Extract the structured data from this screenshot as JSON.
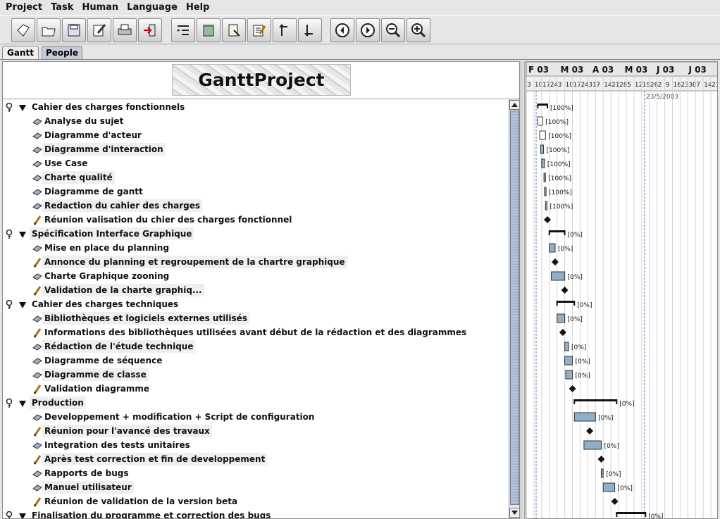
{
  "menu": [
    "Project",
    "Task",
    "Human",
    "Language",
    "Help"
  ],
  "toolbar": [
    {
      "name": "new-icon"
    },
    {
      "name": "open-icon"
    },
    {
      "name": "save-icon"
    },
    {
      "name": "edit-icon"
    },
    {
      "name": "print-icon"
    },
    {
      "name": "exit-icon"
    },
    {
      "name": "new-task-icon"
    },
    {
      "name": "delete-task-icon"
    },
    {
      "name": "task-properties-icon"
    },
    {
      "name": "task-notes-icon"
    },
    {
      "name": "unindent-icon"
    },
    {
      "name": "indent-icon"
    },
    {
      "name": "scroll-back-icon"
    },
    {
      "name": "scroll-forward-icon"
    },
    {
      "name": "zoom-out-icon"
    },
    {
      "name": "zoom-in-icon"
    }
  ],
  "tabs": {
    "gantt": "Gantt",
    "people": "People"
  },
  "logo": "GanttProject",
  "tasks": [
    {
      "label": "Cahier des charges fonctionnels",
      "kind": "group",
      "hl": false
    },
    {
      "label": "Analyse du sujet",
      "kind": "task",
      "hl": false
    },
    {
      "label": "Diagramme d'acteur",
      "kind": "task",
      "hl": false
    },
    {
      "label": "Diagramme d'interaction",
      "kind": "task",
      "hl": true
    },
    {
      "label": "Use Case",
      "kind": "task",
      "hl": false
    },
    {
      "label": "Charte qualité",
      "kind": "task",
      "hl": true
    },
    {
      "label": "Diagramme de gantt",
      "kind": "task",
      "hl": false
    },
    {
      "label": "Redaction du cahier des charges",
      "kind": "task",
      "hl": true
    },
    {
      "label": "Réunion valisation du chier des charges fonctionnel",
      "kind": "milestone",
      "hl": false
    },
    {
      "label": "Spécification Interface Graphique",
      "kind": "group",
      "hl": true
    },
    {
      "label": "Mise en place du planning",
      "kind": "task",
      "hl": false
    },
    {
      "label": "Annonce du planning et regroupement de la chartre graphique",
      "kind": "milestone",
      "hl": true
    },
    {
      "label": "Charte Graphique zooning",
      "kind": "task",
      "hl": false
    },
    {
      "label": "Validation de la charte graphiq...",
      "kind": "milestone",
      "hl": true
    },
    {
      "label": "Cahier des charges techniques",
      "kind": "group",
      "hl": false
    },
    {
      "label": "Bibliothèques et logiciels externes utilisés",
      "kind": "task",
      "hl": true
    },
    {
      "label": "Informations des bibliothèques utilisées avant début de la rédaction et des diagrammes",
      "kind": "milestone",
      "hl": false
    },
    {
      "label": "Rédaction de l'étude technique",
      "kind": "task",
      "hl": true
    },
    {
      "label": "Diagramme de séquence",
      "kind": "task",
      "hl": false
    },
    {
      "label": "Diagramme de classe",
      "kind": "task",
      "hl": true
    },
    {
      "label": "Validation diagramme",
      "kind": "milestone",
      "hl": false
    },
    {
      "label": "Production",
      "kind": "group",
      "hl": true
    },
    {
      "label": "Developpement + modification + Script de configuration",
      "kind": "task",
      "hl": false
    },
    {
      "label": "Réunion pour l'avancé des travaux",
      "kind": "milestone",
      "hl": true
    },
    {
      "label": "Integration des tests unitaires",
      "kind": "task",
      "hl": false
    },
    {
      "label": "Après test correction et fin de developpement",
      "kind": "milestone",
      "hl": true
    },
    {
      "label": "Rapports de bugs",
      "kind": "task",
      "hl": false
    },
    {
      "label": "Manuel utilisateur",
      "kind": "task",
      "hl": true
    },
    {
      "label": "Réunion de validation de la version beta",
      "kind": "milestone",
      "hl": false
    },
    {
      "label": "Finalisation du programme et correction des bugs",
      "kind": "group",
      "hl": false
    }
  ],
  "timeline": {
    "months": [
      {
        "label": "F",
        "year": "03"
      },
      {
        "label": "M",
        "year": "03"
      },
      {
        "label": "A",
        "year": "03"
      },
      {
        "label": "M",
        "year": "03"
      },
      {
        "label": "J",
        "year": "03"
      },
      {
        "label": "J",
        "year": "03"
      }
    ],
    "days": [
      "3",
      "10",
      "17",
      "24",
      "3",
      "10",
      "17",
      "24",
      "31",
      "7",
      "14",
      "21",
      "28",
      "5",
      "12",
      "19",
      "26",
      "2",
      "9",
      "16",
      "23",
      "30",
      "7",
      "14",
      "21"
    ],
    "today_label": "23/5/2003"
  },
  "bars": [
    {
      "type": "summary",
      "start": 0.06,
      "end": 0.11,
      "pct": "[100%]"
    },
    {
      "type": "task",
      "start": 0.06,
      "end": 0.085,
      "pct": "[100%]",
      "outline": true
    },
    {
      "type": "task",
      "start": 0.07,
      "end": 0.1,
      "pct": "[100%]",
      "outline": true
    },
    {
      "type": "task",
      "start": 0.075,
      "end": 0.09,
      "pct": "[100%]"
    },
    {
      "type": "task",
      "start": 0.08,
      "end": 0.095,
      "pct": "[100%]"
    },
    {
      "type": "task",
      "start": 0.092,
      "end": 0.1,
      "pct": "[100%]"
    },
    {
      "type": "task",
      "start": 0.095,
      "end": 0.103,
      "pct": "[100%]"
    },
    {
      "type": "task",
      "start": 0.1,
      "end": 0.108,
      "pct": "[100%]"
    },
    {
      "type": "milestone",
      "start": 0.11,
      "pct": ""
    },
    {
      "type": "summary",
      "start": 0.12,
      "end": 0.2,
      "pct": "[0%]"
    },
    {
      "type": "task",
      "start": 0.12,
      "end": 0.15,
      "pct": "[0%]"
    },
    {
      "type": "milestone",
      "start": 0.15,
      "pct": ""
    },
    {
      "type": "task",
      "start": 0.13,
      "end": 0.2,
      "pct": "[0%]"
    },
    {
      "type": "milestone",
      "start": 0.2,
      "pct": ""
    },
    {
      "type": "summary",
      "start": 0.16,
      "end": 0.25,
      "pct": "[0%]"
    },
    {
      "type": "task",
      "start": 0.16,
      "end": 0.2,
      "pct": "[0%]"
    },
    {
      "type": "milestone",
      "start": 0.19,
      "pct": ""
    },
    {
      "type": "task",
      "start": 0.2,
      "end": 0.22,
      "pct": "[0%]"
    },
    {
      "type": "task",
      "start": 0.2,
      "end": 0.24,
      "pct": "[0%]"
    },
    {
      "type": "task",
      "start": 0.205,
      "end": 0.24,
      "pct": "[0%]"
    },
    {
      "type": "milestone",
      "start": 0.24,
      "pct": ""
    },
    {
      "type": "summary",
      "start": 0.25,
      "end": 0.47,
      "pct": "[0%]"
    },
    {
      "type": "task",
      "start": 0.25,
      "end": 0.36,
      "pct": "[0%]"
    },
    {
      "type": "milestone",
      "start": 0.33,
      "pct": ""
    },
    {
      "type": "task",
      "start": 0.3,
      "end": 0.39,
      "pct": "[0%]"
    },
    {
      "type": "milestone",
      "start": 0.39,
      "pct": ""
    },
    {
      "type": "task",
      "start": 0.39,
      "end": 0.4,
      "pct": "[0%]"
    },
    {
      "type": "task",
      "start": 0.4,
      "end": 0.46,
      "pct": "[0%]"
    },
    {
      "type": "milestone",
      "start": 0.46,
      "pct": ""
    },
    {
      "type": "summary",
      "start": 0.47,
      "end": 0.62,
      "pct": "[0%]"
    }
  ]
}
